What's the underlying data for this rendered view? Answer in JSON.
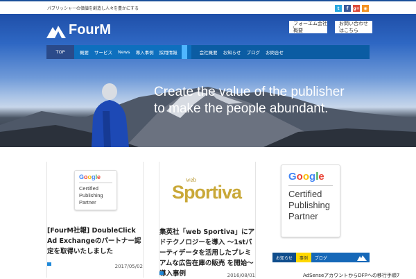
{
  "topbar": {
    "tagline": "パブリッシャーの価値を創造し人々を豊かにする",
    "social": [
      {
        "icon": "twitter-icon",
        "glyph": "t",
        "color": "#2aa9e0"
      },
      {
        "icon": "facebook-icon",
        "glyph": "f",
        "color": "#3b5998"
      },
      {
        "icon": "googleplus-icon",
        "glyph": "g+",
        "color": "#dd4b39"
      },
      {
        "icon": "rss-icon",
        "glyph": "◉",
        "color": "#f49322"
      }
    ]
  },
  "header": {
    "logo_text": "FourM",
    "buttons": [
      "フォーエム会社概要",
      "お問い合わせはこちら"
    ]
  },
  "nav": {
    "top": "TOP",
    "group1": [
      "概要",
      "サービス",
      "News",
      "導入事例",
      "採用情報"
    ],
    "group2": [
      "会社概要",
      "お知らせ",
      "ブログ",
      "お問合せ"
    ]
  },
  "hero": {
    "line1": "Create the value of the publisher",
    "line2": "to make the people abundant."
  },
  "cards": [
    {
      "title": "[FourM社報] DoubleClick Ad Exchangeのパートナー認定を取得いたしました",
      "date": "2017/05/02",
      "badge": [
        "Google",
        "Certified",
        "Publishing",
        "Partner"
      ]
    },
    {
      "title": "集英社「web Sportiva」にアドテクノロジーを導入 〜1stパーティデータを活用したプレミアムな広告在庫の販売 を開始〜　導入事例",
      "date": "2016/08/01",
      "logo_small": "web",
      "logo_big": "Sportiva"
    }
  ],
  "sidebar": {
    "badge": [
      "Google",
      "Certified",
      "Publishing",
      "Partner"
    ],
    "tabs": [
      "お知らせ",
      "事例",
      "ブログ"
    ],
    "item": "AdSenseアカウントからDFPへの移行手順7"
  },
  "colors": {
    "accent_blue": "#0e6fbe",
    "nav_highlight": "#4fb6ff",
    "tab_yellow": "#ffd800"
  }
}
